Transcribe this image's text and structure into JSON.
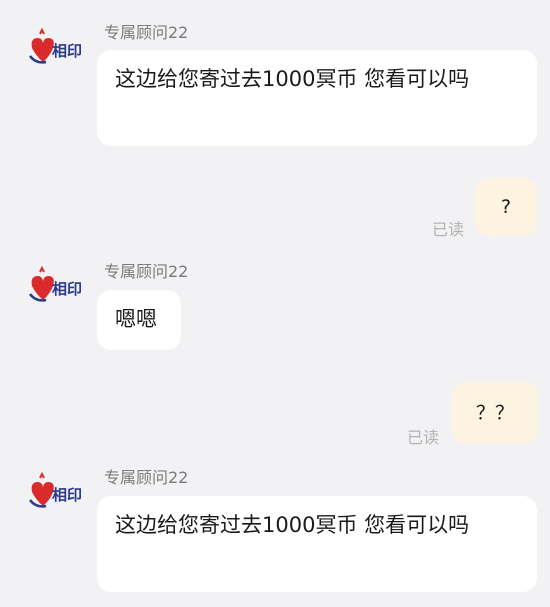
{
  "messages": [
    {
      "sender": "专属顾问22",
      "text": "这边给您寄过去1000冥币 您看可以吗"
    },
    {
      "text": "?",
      "status": "已读"
    },
    {
      "sender": "专属顾问22",
      "text": "嗯嗯"
    },
    {
      "text": "？？",
      "status": "已读"
    },
    {
      "sender": "专属顾问22",
      "text": "这边给您寄过去1000冥币 您看可以吗"
    }
  ],
  "colors": {
    "background": "#f2f2f4",
    "incoming_bubble": "#ffffff",
    "outgoing_bubble": "#fdf3e1",
    "logo_red": "#d92b2b",
    "logo_blue": "#2b3a8c"
  },
  "icons": {
    "avatar": "brand-logo-icon"
  }
}
